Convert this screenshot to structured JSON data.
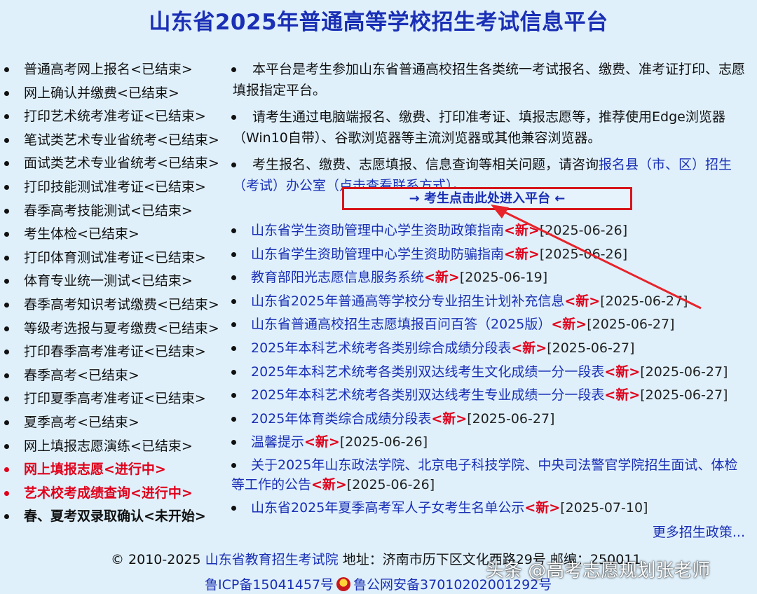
{
  "page": {
    "title": "山东省2025年普通高等学校招生考试信息平台"
  },
  "left_nav": [
    {
      "label": "普通高考网上报名<已结束>",
      "state": "ended"
    },
    {
      "label": "网上确认并缴费<已结束>",
      "state": "ended"
    },
    {
      "label": "打印艺术统考准考证<已结束>",
      "state": "ended"
    },
    {
      "label": "笔试类艺术专业省统考<已结束>",
      "state": "ended"
    },
    {
      "label": "面试类艺术专业省统考<已结束>",
      "state": "ended"
    },
    {
      "label": "打印技能测试准考证<已结束>",
      "state": "ended"
    },
    {
      "label": "春季高考技能测试<已结束>",
      "state": "ended"
    },
    {
      "label": "考生体检<已结束>",
      "state": "ended"
    },
    {
      "label": "打印体育测试准考证<已结束>",
      "state": "ended"
    },
    {
      "label": "体育专业统一测试<已结束>",
      "state": "ended"
    },
    {
      "label": "春季高考知识考试缴费<已结束>",
      "state": "ended"
    },
    {
      "label": "等级考选报与夏考缴费<已结束>",
      "state": "ended"
    },
    {
      "label": "打印春季高考准考证<已结束>",
      "state": "ended"
    },
    {
      "label": "春季高考<已结束>",
      "state": "ended"
    },
    {
      "label": "打印夏季高考准考证<已结束>",
      "state": "ended"
    },
    {
      "label": "夏季高考<已结束>",
      "state": "ended"
    },
    {
      "label": "网上填报志愿演练<已结束>",
      "state": "ended"
    },
    {
      "label": "网上填报志愿<进行中>",
      "state": "active"
    },
    {
      "label": "艺术校考成绩查询<进行中>",
      "state": "active"
    },
    {
      "label": "春、夏考双录取确认<未开始>",
      "state": "pending"
    }
  ],
  "notices": {
    "n1": "本平台是考生参加山东省普通高校招生各类统一考试报名、缴费、准考证打印、志愿填报指定平台。",
    "n2": "请考生通过电脑端报名、缴费、打印准考证、填报志愿等，推荐使用Edge浏览器（Win10自带）、谷歌浏览器等主流浏览器或其他兼容浏览器。",
    "n3_prefix": "考生报名、缴费、志愿填报、信息查询等相关问题，请咨询",
    "n3_link": "报名县（市、区）招生（考试）办公室（点击查看联系方式）",
    "n3_suffix": "。"
  },
  "enter_button": {
    "label": "→ 考生点击此处进入平台 ←"
  },
  "news": [
    {
      "title": "山东省学生资助管理中心学生资助政策指南",
      "tag": "<新>",
      "date": "[2025-06-26]"
    },
    {
      "title": "山东省学生资助管理中心学生资助防骗指南",
      "tag": "<新>",
      "date": "[2025-06-26]"
    },
    {
      "title": "教育部阳光志愿信息服务系统",
      "tag": "<新>",
      "date": "[2025-06-19]"
    },
    {
      "title": "山东省2025年普通高等学校分专业招生计划补充信息",
      "tag": "<新>",
      "date": "[2025-06-27]"
    },
    {
      "title": "山东省普通高校招生志愿填报百问百答（2025版）",
      "tag": "<新>",
      "date": "[2025-06-27]"
    },
    {
      "title": "2025年本科艺术统考各类别综合成绩分段表",
      "tag": "<新>",
      "date": "[2025-06-27]"
    },
    {
      "title": "2025年本科艺术统考各类别双达线考生文化成绩一分一段表",
      "tag": "<新>",
      "date": "[2025-06-27]"
    },
    {
      "title": "2025年本科艺术统考各类别双达线考生专业成绩一分一段表",
      "tag": "<新>",
      "date": "[2025-06-27]"
    },
    {
      "title": "2025年体育类综合成绩分段表",
      "tag": "<新>",
      "date": "[2025-06-27]"
    },
    {
      "title": "温馨提示",
      "tag": "<新>",
      "date": "[2025-06-26]"
    },
    {
      "title": "关于2025年山东政法学院、北京电子科技学院、中央司法警官学院招生面试、体检等工作的公告",
      "tag": "<新>",
      "date": "[2025-06-26]",
      "wrap": true
    },
    {
      "title": "山东省2025年夏季高考军人子女考生名单公示",
      "tag": "<新>",
      "date": "[2025-07-10]"
    }
  ],
  "more_link": "更多招生政策...",
  "footer": {
    "copyright": "© 2010-2025",
    "org": "山东省教育招生考试院",
    "address": "地址：济南市历下区文化西路29号 邮编：250011",
    "icp": "鲁ICP备15041457号",
    "police": "鲁公网安备37010202001292号"
  },
  "watermark": "头条 @高考志愿规划张老师",
  "colors": {
    "background": "#dff0fb",
    "link": "#1a2fb5",
    "new_tag": "#e0001b",
    "highlight_border": "#d6151b"
  }
}
